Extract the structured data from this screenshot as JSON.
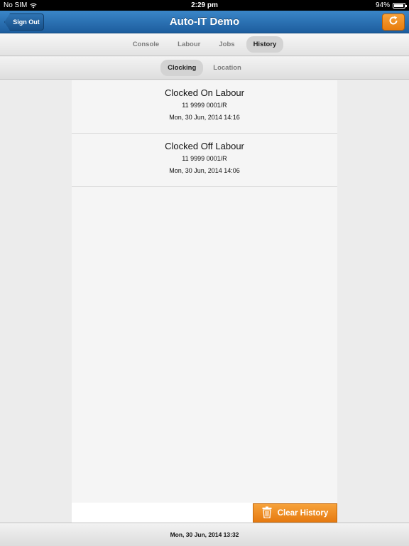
{
  "status_bar": {
    "carrier": "No SIM",
    "time": "2:29 pm",
    "battery_percent": "94%",
    "battery_level": 0.94
  },
  "nav": {
    "title": "Auto-IT Demo",
    "sign_out_label": "Sign Out",
    "refresh_icon": "refresh-icon"
  },
  "tabs": [
    {
      "label": "Console",
      "active": false
    },
    {
      "label": "Labour",
      "active": false
    },
    {
      "label": "Jobs",
      "active": false
    },
    {
      "label": "History",
      "active": true
    }
  ],
  "sub_tabs": [
    {
      "label": "Clocking",
      "active": true
    },
    {
      "label": "Location",
      "active": false
    }
  ],
  "history": [
    {
      "title": "Clocked On Labour",
      "ref": "11 9999 0001/R",
      "date": "Mon, 30 Jun, 2014 14:16"
    },
    {
      "title": "Clocked Off Labour",
      "ref": "11 9999 0001/R",
      "date": "Mon, 30 Jun, 2014 14:06"
    }
  ],
  "clear_history_label": "Clear History",
  "footer_date": "Mon, 30 Jun, 2014 13:32",
  "colors": {
    "nav_blue": "#2a72b8",
    "accent_orange": "#f0901f"
  }
}
